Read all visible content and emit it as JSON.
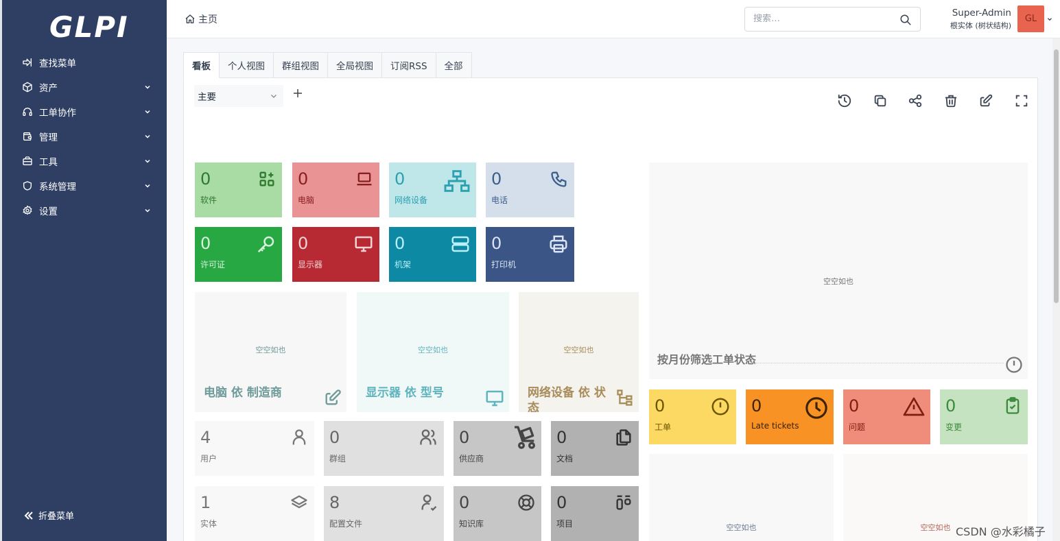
{
  "sidebar": {
    "logo": "GLPI",
    "items": [
      {
        "label": "查找菜单",
        "icon": "arrow-right-to-bracket-icon",
        "has_chevron": false
      },
      {
        "label": "资产",
        "icon": "box-icon",
        "has_chevron": true
      },
      {
        "label": "工单协作",
        "icon": "headset-icon",
        "has_chevron": true
      },
      {
        "label": "管理",
        "icon": "wallet-icon",
        "has_chevron": true
      },
      {
        "label": "工具",
        "icon": "briefcase-icon",
        "has_chevron": true
      },
      {
        "label": "系统管理",
        "icon": "shield-icon",
        "has_chevron": true
      },
      {
        "label": "设置",
        "icon": "gear-icon",
        "has_chevron": true
      }
    ],
    "collapse_label": "折叠菜单"
  },
  "header": {
    "breadcrumb": "主页",
    "search_placeholder": "搜索…",
    "user_name": "Super-Admin",
    "user_entity": "根实体 (树状结构)",
    "avatar_initials": "GL"
  },
  "tabs": [
    "看板",
    "个人视图",
    "群组视图",
    "全局视图",
    "订阅RSS",
    "全部"
  ],
  "dashboard": {
    "selected": "主要",
    "toolbar": [
      "history-icon",
      "copy-icon",
      "share-icon",
      "trash-icon",
      "edit-icon",
      "fullscreen-icon"
    ]
  },
  "tiles": [
    {
      "num": "0",
      "label": "软件",
      "icon": "apps-add-icon",
      "bg": "#a9dba5",
      "fg": "#2f7a2f"
    },
    {
      "num": "0",
      "label": "电脑",
      "icon": "laptop-icon",
      "bg": "#e99394",
      "fg": "#8a1f22"
    },
    {
      "num": "0",
      "label": "网络设备",
      "icon": "network-icon",
      "bg": "#bfe6e8",
      "fg": "#2ba1b1"
    },
    {
      "num": "0",
      "label": "电话",
      "icon": "phone-icon",
      "bg": "#d4dfeb",
      "fg": "#3c5e8a"
    },
    {
      "num": "0",
      "label": "许可证",
      "icon": "key-icon",
      "bg": "#27a843",
      "fg": "#d7f3dc"
    },
    {
      "num": "0",
      "label": "显示器",
      "icon": "monitor-icon",
      "bg": "#b82a33",
      "fg": "#f3d2d4"
    },
    {
      "num": "0",
      "label": "机架",
      "icon": "server-icon",
      "bg": "#0d89a3",
      "fg": "#b9f0fb"
    },
    {
      "num": "0",
      "label": "打印机",
      "icon": "printer-icon",
      "bg": "#3a5586",
      "fg": "#dbe4f3"
    },
    {
      "num": "0",
      "label": "工单",
      "icon": "alert-circle-icon",
      "bg": "#fcd963",
      "fg": "#6c5500"
    },
    {
      "num": "0",
      "label": "Late tickets",
      "icon": "clock-icon",
      "bg": "#f89224",
      "fg": "#3b2200"
    },
    {
      "num": "0",
      "label": "问题",
      "icon": "alert-triangle-icon",
      "bg": "#ef8c7a",
      "fg": "#7c1f10"
    },
    {
      "num": "0",
      "label": "变更",
      "icon": "clipboard-check-icon",
      "bg": "#c6e3c1",
      "fg": "#3d8a3d"
    },
    {
      "num": "4",
      "label": "用户",
      "icon": "user-icon",
      "bg": "#f8f8f8",
      "fg": "#777"
    },
    {
      "num": "0",
      "label": "群组",
      "icon": "users-icon",
      "bg": "#e0e0e0",
      "fg": "#666"
    },
    {
      "num": "0",
      "label": "供应商",
      "icon": "dolly-icon",
      "bg": "#c6c6c6",
      "fg": "#444"
    },
    {
      "num": "0",
      "label": "文档",
      "icon": "files-icon",
      "bg": "#b1b1b1",
      "fg": "#333"
    },
    {
      "num": "1",
      "label": "实体",
      "icon": "layers-icon",
      "bg": "#f8f8f8",
      "fg": "#777"
    },
    {
      "num": "8",
      "label": "配置文件",
      "icon": "user-check-icon",
      "bg": "#e0e0e0",
      "fg": "#666"
    },
    {
      "num": "0",
      "label": "知识库",
      "icon": "lifebuoy-icon",
      "bg": "#c6c6c6",
      "fg": "#444"
    },
    {
      "num": "0",
      "label": "项目",
      "icon": "layout-kanban-icon",
      "bg": "#b1b1b1",
      "fg": "#333"
    }
  ],
  "panels": [
    {
      "empty": "空空如也",
      "title": "电脑 依 制造商",
      "icon": "edit-icon",
      "bg": "#f7f7f7",
      "fg": "#6f9a9a"
    },
    {
      "empty": "空空如也",
      "title": "显示器 依 型号",
      "icon": "monitor-icon",
      "bg": "#f1f8f8",
      "fg": "#5fb4bd"
    },
    {
      "empty": "空空如也",
      "title": "网络设备 依 状态",
      "icon": "tree-icon",
      "bg": "#f5f3ee",
      "fg": "#a88c5a"
    },
    {
      "empty": "空空如也",
      "title": "按月份筛选工单状态",
      "icon": "info-circle-icon",
      "bg": "#f8f8f8",
      "fg": "#777"
    },
    {
      "empty": "空空如也",
      "title": "",
      "icon": "",
      "bg": "#f8f8f8",
      "fg": "#6b7d93"
    },
    {
      "empty": "空空如也",
      "title": "",
      "icon": "",
      "bg": "#fbf8f8",
      "fg": "#b5665a"
    }
  ],
  "watermark": "CSDN @水彩橘子"
}
